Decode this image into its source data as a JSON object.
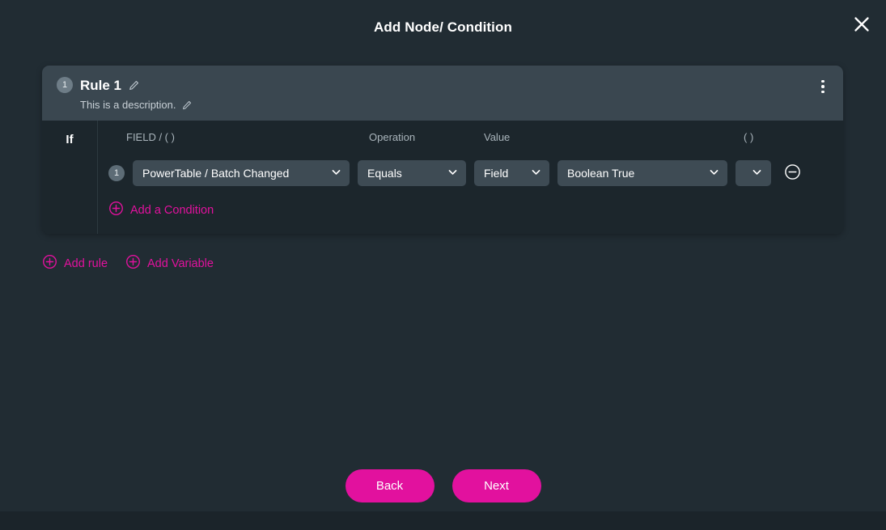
{
  "modal": {
    "title": "Add Node/ Condition",
    "close_icon": "close-icon"
  },
  "rule": {
    "number": "1",
    "title": "Rule 1",
    "description": "This is a description.",
    "edit_icon": "pencil-icon",
    "menu_icon": "kebab-menu-icon"
  },
  "logic": {
    "if_label": "If"
  },
  "columns": {
    "field": "FIELD / ( )",
    "operation": "Operation",
    "value": "Value",
    "paren": "( )"
  },
  "condition": {
    "number": "1",
    "field": "PowerTable / Batch Changed",
    "operation": "Equals",
    "value_type": "Field",
    "value": "Boolean True",
    "paren": "",
    "chevron_icon": "chevron-down-icon",
    "remove_icon": "circle-minus-icon"
  },
  "actions": {
    "add_condition": "Add a Condition",
    "add_rule": "Add rule",
    "add_variable": "Add Variable",
    "plus_icon": "circle-plus-icon"
  },
  "footer": {
    "back": "Back",
    "next": "Next"
  },
  "colors": {
    "accent": "#e2119e",
    "page_bg": "#212c33",
    "card_header_bg": "#3a4750",
    "card_body_bg": "#1c262c",
    "dropdown_bg": "#3e4b54"
  }
}
